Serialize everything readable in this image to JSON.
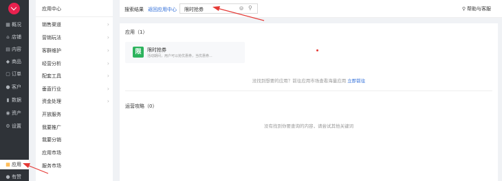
{
  "sidebar": {
    "items": [
      {
        "icon": "grid-icon",
        "label": "概况"
      },
      {
        "icon": "shop-icon",
        "label": "店铺"
      },
      {
        "icon": "content-icon",
        "label": "内容"
      },
      {
        "icon": "tag-icon",
        "label": "商品"
      },
      {
        "icon": "order-icon",
        "label": "订单"
      },
      {
        "icon": "customer-icon",
        "label": "客户"
      },
      {
        "icon": "chart-icon",
        "label": "数据"
      },
      {
        "icon": "asset-icon",
        "label": "资产"
      },
      {
        "icon": "settings-icon",
        "label": "设置"
      },
      {
        "icon": "apps-icon",
        "label": "应用"
      },
      {
        "icon": "like-icon",
        "label": "有赞"
      }
    ],
    "active_index": 9
  },
  "menu": {
    "title": "应用中心",
    "items": [
      {
        "label": "销售渠道",
        "chevron": true
      },
      {
        "label": "营销玩法",
        "chevron": true
      },
      {
        "label": "客群维护",
        "chevron": true
      },
      {
        "label": "经营分析",
        "chevron": true
      },
      {
        "label": "配套工具",
        "chevron": true
      },
      {
        "label": "垂直行业",
        "chevron": true
      },
      {
        "label": "资金处理",
        "chevron": true
      },
      {
        "label": "开放服务",
        "chevron": false
      },
      {
        "label": "我要推广",
        "chevron": false
      },
      {
        "label": "我要分销",
        "chevron": false
      },
      {
        "label": "应用市场",
        "chevron": false
      },
      {
        "label": "服务市场",
        "chevron": false
      }
    ]
  },
  "topbar": {
    "label": "搜索结果",
    "back_link": "返回应用中心",
    "search_value": "限时抢券",
    "help": "帮助与客服"
  },
  "main": {
    "apps_section": "应用（1）",
    "app_card": {
      "icon_char": "限",
      "name": "限时抢券",
      "desc": "活动期间，用户可以抢优惠券，当优惠券..."
    },
    "apps_hint": "没找到想要的应用？前往应用市场查看海量应用",
    "apps_hint_link": "立即前往",
    "guide_section": "运营攻略（0）",
    "guide_empty": "没有找到你要查询的内容，请尝试其他关键词"
  },
  "colors": {
    "sidebar_bg": "#2f3338",
    "accent_red": "#e8214e",
    "link_blue": "#2a6ad8",
    "app_icon_green": "#2db35d"
  }
}
